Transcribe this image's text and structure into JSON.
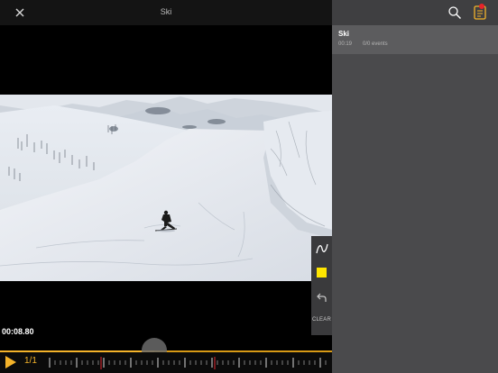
{
  "player": {
    "title": "Ski",
    "timecode": "00:08.80",
    "speed": "1/1",
    "progress_fraction": 0.465
  },
  "tools": {
    "clear_label": "CLEAR",
    "active_color": "#ffe600"
  },
  "panel": {
    "items": [
      {
        "title": "Ski",
        "duration": "00:19",
        "events": "0/0 events"
      }
    ]
  },
  "colors": {
    "accent": "#f4b32a",
    "panel_bg": "#4a4a4c",
    "selected_row": "#5c5c5e",
    "badge": "#e8242a"
  }
}
